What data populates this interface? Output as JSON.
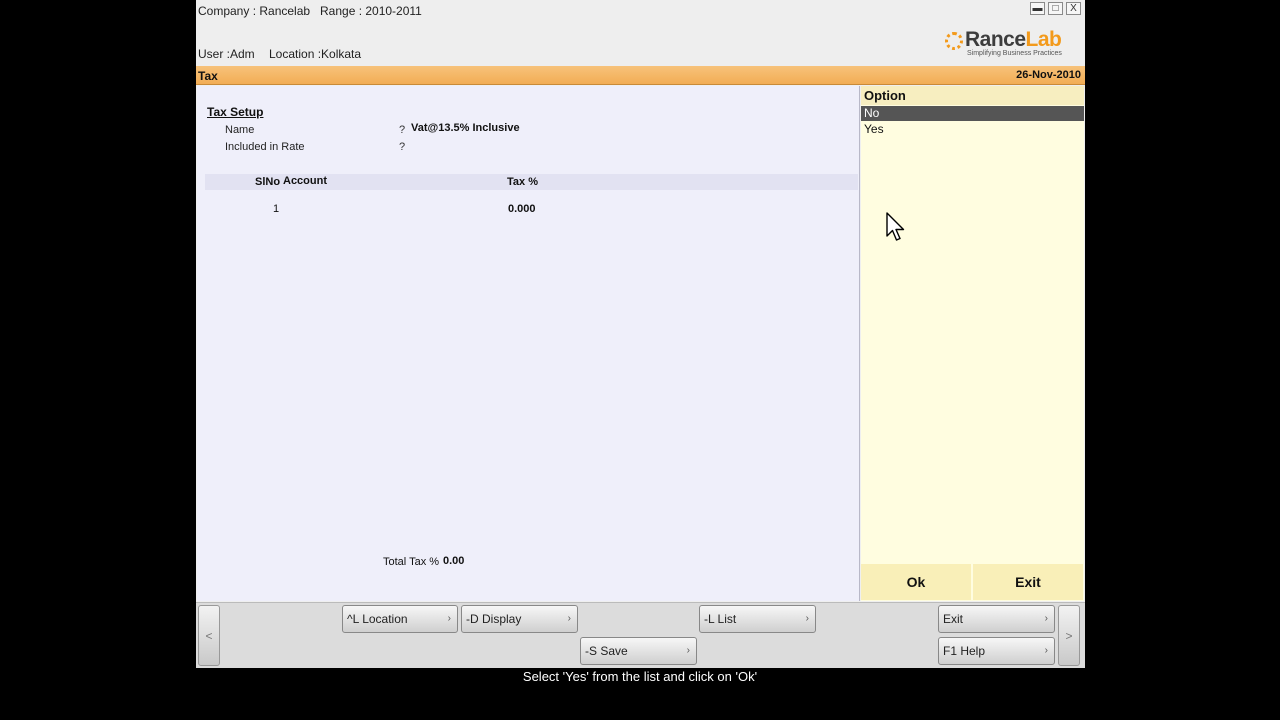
{
  "header": {
    "company": "Company : Rancelab",
    "range": "Range : 2010-2011",
    "user": "User :Adm",
    "location": "Location :Kolkata",
    "window_controls": {
      "minimize": "▬",
      "maximize": "□",
      "close": "X"
    },
    "logo": {
      "name_part1": "Rance",
      "name_part2": "Lab",
      "tagline": "Simplifying Business Practices",
      "accent_color": "#f39a1b"
    }
  },
  "titlebar": {
    "title": "Tax",
    "date": "26-Nov-2010",
    "color": "#f2ad55"
  },
  "form": {
    "section_title": "Tax Setup",
    "name_label": "Name",
    "name_marker": "?",
    "name_value": "Vat@13.5% Inclusive",
    "included_label": "Included in Rate",
    "included_marker": "?",
    "columns": {
      "slno": "SlNo",
      "account": "Account",
      "tax": "Tax %"
    },
    "rows": [
      {
        "slno": "1",
        "account": "",
        "tax": "0.000"
      }
    ],
    "total_label": "Total Tax %",
    "total_value": "0.00"
  },
  "options": {
    "header": "Option",
    "items": [
      "No",
      "Yes"
    ],
    "selected_index": 0,
    "ok_label": "Ok",
    "exit_label": "Exit"
  },
  "toolbar": {
    "location": "^L Location",
    "display": "-D Display",
    "list": "-L List",
    "exit": "Exit",
    "save": "-S Save",
    "help": "F1 Help",
    "arrow": "›",
    "prev": "<",
    "next": ">"
  },
  "caption": "Select 'Yes' from the list and click on 'Ok'"
}
